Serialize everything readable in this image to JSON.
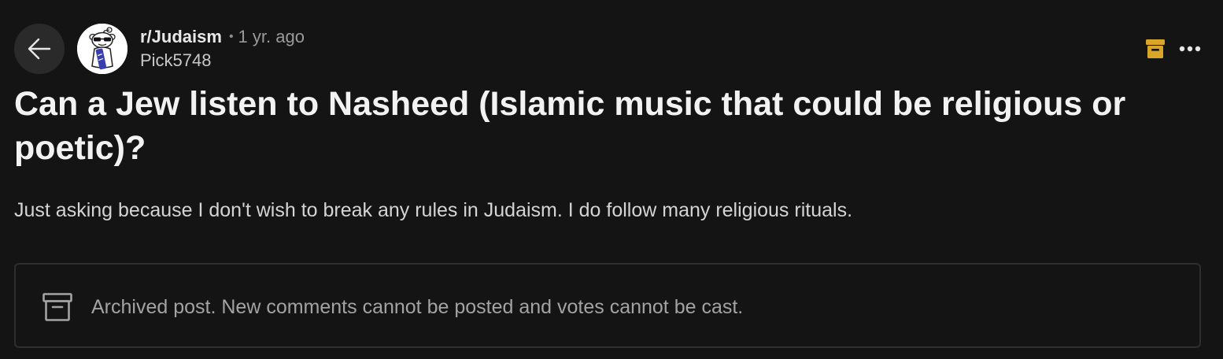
{
  "header": {
    "subreddit": "r/Judaism",
    "separator": "•",
    "post_age": "1 yr. ago",
    "author": "Pick5748"
  },
  "icons": {
    "back": "arrow-left-icon",
    "avatar": "subreddit-snoo-avatar",
    "archive_status": "archive-box-icon",
    "more": "ellipsis-icon",
    "banner": "archive-box-icon"
  },
  "post": {
    "title": "Can a Jew listen to Nasheed (Islamic music that could be religious or poetic)?",
    "body": "Just asking because I don't wish to break any rules in Judaism. I do follow many religious rituals."
  },
  "archived_banner": {
    "text": "Archived post. New comments cannot be posted and votes cannot be cast."
  },
  "colors": {
    "background": "#141414",
    "archive_accent": "#d9a526",
    "avatar_robe": "#3a3fb0"
  }
}
